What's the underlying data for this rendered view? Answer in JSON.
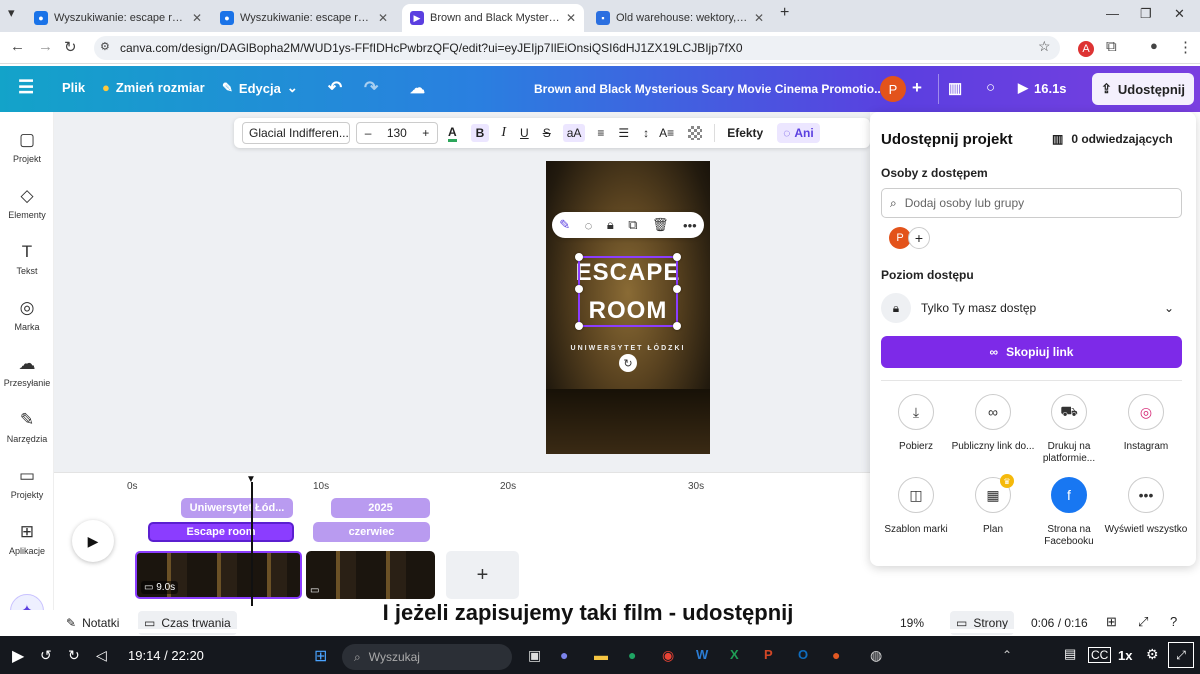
{
  "browser": {
    "tabs": [
      {
        "title": "Wyszukiwanie: escape room – O",
        "active": false
      },
      {
        "title": "Wyszukiwanie: escape room – O",
        "active": false
      },
      {
        "title": "Brown and Black Mysterious Sc",
        "active": true
      },
      {
        "title": "Old warehouse: wektory, zdjęc",
        "active": false
      }
    ],
    "url": "canva.com/design/DAGlBopha2M/WUD1ys-FFfIDHcPwbrzQFQ/edit?ui=eyJEIjp7IlEiOnsiQSI6dHJ1ZX19LCJBIjp7fX0"
  },
  "canva_header": {
    "file": "Plik",
    "resize": "Zmień rozmiar",
    "edit": "Edycja",
    "title": "Brown and Black Mysterious Scary Movie Cinema Promotio...",
    "avatar": "P",
    "duration": "16.1s",
    "share": "Udostępnij"
  },
  "left_rail": [
    "Projekt",
    "Elementy",
    "Tekst",
    "Marka",
    "Przesyłanie",
    "Narzędzia",
    "Projekty",
    "Aplikacje"
  ],
  "text_toolbar": {
    "font": "Glacial Indifferen...",
    "size": "130",
    "effects": "Efekty",
    "animate": "Ani"
  },
  "poster": {
    "line1": "ESCAPE",
    "line2": "ROOM",
    "subtitle": "UNIWERSYTET ŁÓDZKI"
  },
  "timeline": {
    "ticks": [
      "0s",
      "10s",
      "20s",
      "30s"
    ],
    "pills": [
      "Uniwersytet Łód...",
      "Escape room",
      "2025",
      "czerwiec"
    ],
    "clip_duration": "9.0s",
    "add": "+"
  },
  "share_panel": {
    "title": "Udostępnij projekt",
    "visitors": "0 odwiedzających",
    "people_label": "Osoby z dostępem",
    "search_placeholder": "Dodaj osoby lub grupy",
    "avatar": "P",
    "access_label": "Poziom dostępu",
    "access_value": "Tylko Ty masz dostęp",
    "copy_link": "Skopiuj link",
    "options": [
      {
        "label": "Pobierz",
        "icon": "download-icon"
      },
      {
        "label": "Publiczny link do...",
        "icon": "link-icon"
      },
      {
        "label": "Drukuj na platformie...",
        "icon": "truck-icon"
      },
      {
        "label": "Instagram",
        "icon": "instagram-icon"
      },
      {
        "label": "Szablon marki",
        "icon": "template-icon"
      },
      {
        "label": "Plan",
        "icon": "calendar-icon"
      },
      {
        "label": "Strona na Facebooku",
        "icon": "facebook-icon"
      },
      {
        "label": "Wyświetl wszystko",
        "icon": "more-icon"
      }
    ]
  },
  "canva_bottom": {
    "notes": "Notatki",
    "duration": "Czas trwania",
    "zoom": "19%",
    "pages": "Strony",
    "time": "0:06 / 0:16"
  },
  "video": {
    "subtitle": "I jeżeli zapisujemy taki film - udostępnij",
    "time": "19:14 / 22:20",
    "speed": "1x",
    "search": "Wyszukaj",
    "progress": 0.86
  },
  "colors": {
    "accent": "#8b3dff",
    "avatar": "#e3531b"
  }
}
